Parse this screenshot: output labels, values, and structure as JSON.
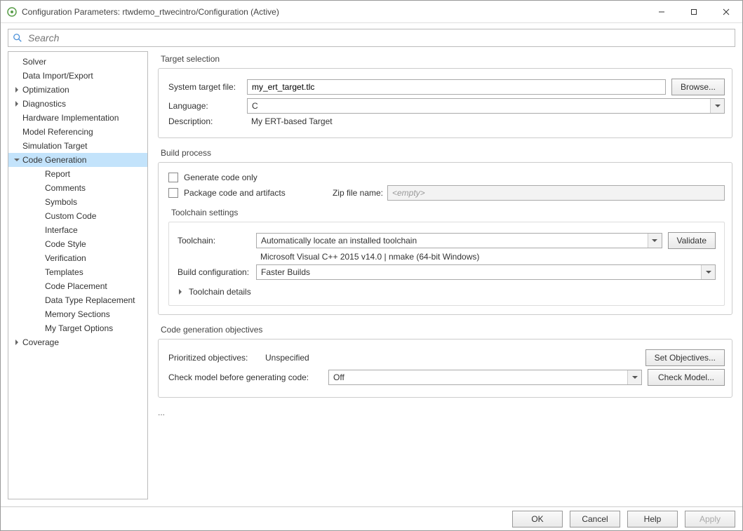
{
  "window": {
    "title": "Configuration Parameters: rtwdemo_rtwecintro/Configuration (Active)"
  },
  "search": {
    "placeholder": "Search"
  },
  "sidebar": {
    "items": [
      {
        "label": "Solver",
        "level": 0,
        "exp": ""
      },
      {
        "label": "Data Import/Export",
        "level": 0,
        "exp": ""
      },
      {
        "label": "Optimization",
        "level": 0,
        "exp": "right"
      },
      {
        "label": "Diagnostics",
        "level": 0,
        "exp": "right"
      },
      {
        "label": "Hardware Implementation",
        "level": 0,
        "exp": ""
      },
      {
        "label": "Model Referencing",
        "level": 0,
        "exp": ""
      },
      {
        "label": "Simulation Target",
        "level": 0,
        "exp": ""
      },
      {
        "label": "Code Generation",
        "level": 0,
        "exp": "down",
        "selected": true
      },
      {
        "label": "Report",
        "level": 1,
        "exp": ""
      },
      {
        "label": "Comments",
        "level": 1,
        "exp": ""
      },
      {
        "label": "Symbols",
        "level": 1,
        "exp": ""
      },
      {
        "label": "Custom Code",
        "level": 1,
        "exp": ""
      },
      {
        "label": "Interface",
        "level": 1,
        "exp": ""
      },
      {
        "label": "Code Style",
        "level": 1,
        "exp": ""
      },
      {
        "label": "Verification",
        "level": 1,
        "exp": ""
      },
      {
        "label": "Templates",
        "level": 1,
        "exp": ""
      },
      {
        "label": "Code Placement",
        "level": 1,
        "exp": ""
      },
      {
        "label": "Data Type Replacement",
        "level": 1,
        "exp": ""
      },
      {
        "label": "Memory Sections",
        "level": 1,
        "exp": ""
      },
      {
        "label": "My Target Options",
        "level": 1,
        "exp": ""
      },
      {
        "label": "Coverage",
        "level": 0,
        "exp": "right"
      }
    ]
  },
  "target_selection": {
    "legend": "Target selection",
    "system_target_file_label": "System target file:",
    "system_target_file": "my_ert_target.tlc",
    "browse": "Browse...",
    "language_label": "Language:",
    "language": "C",
    "description_label": "Description:",
    "description": "My ERT-based Target"
  },
  "build_process": {
    "legend": "Build process",
    "generate_code_only": "Generate code only",
    "package_code": "Package code and artifacts",
    "zip_label": "Zip file name:",
    "zip_placeholder": "<empty>",
    "toolchain_settings_label": "Toolchain settings",
    "toolchain_label": "Toolchain:",
    "toolchain_value": "Automatically locate an installed toolchain",
    "validate": "Validate",
    "toolchain_detail": "Microsoft Visual C++ 2015 v14.0 | nmake (64-bit Windows)",
    "build_config_label": "Build configuration:",
    "build_config_value": "Faster Builds",
    "toolchain_details_toggle": "Toolchain details"
  },
  "objectives": {
    "legend": "Code generation objectives",
    "prioritized_label": "Prioritized objectives:",
    "prioritized_value": "Unspecified",
    "set_objectives": "Set Objectives...",
    "check_label": "Check model before generating code:",
    "check_value": "Off",
    "check_model": "Check Model..."
  },
  "more": "...",
  "footer": {
    "ok": "OK",
    "cancel": "Cancel",
    "help": "Help",
    "apply": "Apply"
  }
}
